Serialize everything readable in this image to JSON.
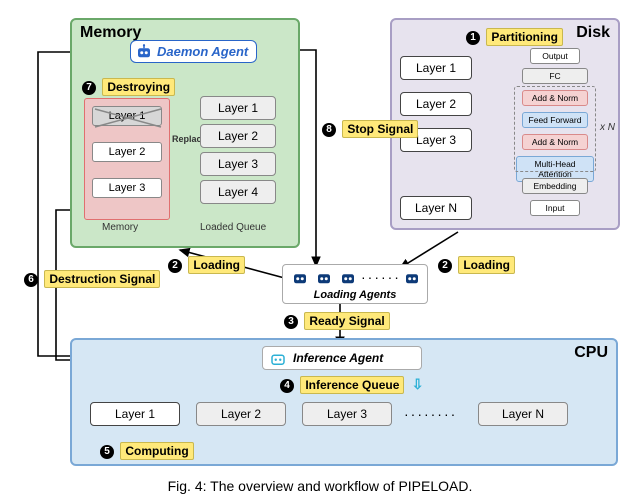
{
  "regions": {
    "memory_title": "Memory",
    "disk_title": "Disk",
    "cpu_title": "CPU"
  },
  "daemon_label": "Daemon Agent",
  "inference_label": "Inference Agent",
  "loading_agents_label": "Loading Agents",
  "memory_block": {
    "slots": [
      "Layer 1",
      "Layer 2",
      "Layer 3"
    ],
    "label": "Memory",
    "replace_label": "Replace"
  },
  "loaded_queue": {
    "items": [
      "Layer 1",
      "Layer 2",
      "Layer 3",
      "Layer 4"
    ],
    "label": "Loaded Queue"
  },
  "disk_layers": [
    "Layer 1",
    "Layer 2",
    "Layer 3",
    "Layer N"
  ],
  "transformer": {
    "output": "Output",
    "fc": "FC",
    "addnorm": "Add & Norm",
    "ff": "Feed Forward",
    "mha": "Multi-Head Attention",
    "embed": "Embedding",
    "input": "Input",
    "xn": "x N"
  },
  "steps": {
    "s1": "Partitioning",
    "s2": "Loading",
    "s3": "Ready Signal",
    "s4": "Inference Queue",
    "s5": "Computing",
    "s6": "Destruction Signal",
    "s7": "Destroying",
    "s8": "Stop Signal"
  },
  "cpu_layers": [
    "Layer 1",
    "Layer 2",
    "Layer 3",
    "Layer N"
  ],
  "caption": "Fig. 4: The overview and workflow of PIPELOAD."
}
